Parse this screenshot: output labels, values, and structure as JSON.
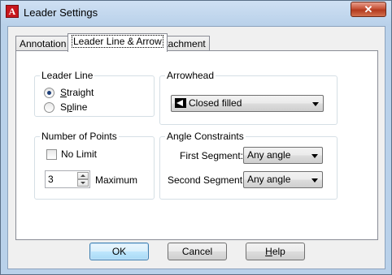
{
  "window": {
    "title": "Leader Settings",
    "app_icon_letter": "A",
    "close_glyph": "✕"
  },
  "tabs": [
    {
      "label": "Annotation",
      "active": false
    },
    {
      "label": "Leader Line & Arrow",
      "active": true
    },
    {
      "label": "Attachment",
      "active": false
    }
  ],
  "leader_line": {
    "title": "Leader Line",
    "options": [
      {
        "label": "Straight",
        "underline_char": "S",
        "rest": "traight",
        "selected": true
      },
      {
        "label": "Spline",
        "underline_char": "p",
        "prefix": "S",
        "rest": "line",
        "selected": false
      }
    ]
  },
  "arrowhead": {
    "title": "Arrowhead",
    "value": "Closed filled",
    "icon": "closed-filled-arrow-icon"
  },
  "points": {
    "title": "Number of Points",
    "no_limit_label": "No Limit",
    "no_limit_checked": false,
    "value": "3",
    "maximum_label": "Maximum"
  },
  "angle": {
    "title": "Angle Constraints",
    "first_label": "First Segment:",
    "first_value": "Any angle",
    "second_label": "Second Segment:",
    "second_value": "Any angle"
  },
  "buttons": {
    "ok": "OK",
    "cancel": "Cancel",
    "help_first": "H",
    "help_rest": "elp"
  }
}
